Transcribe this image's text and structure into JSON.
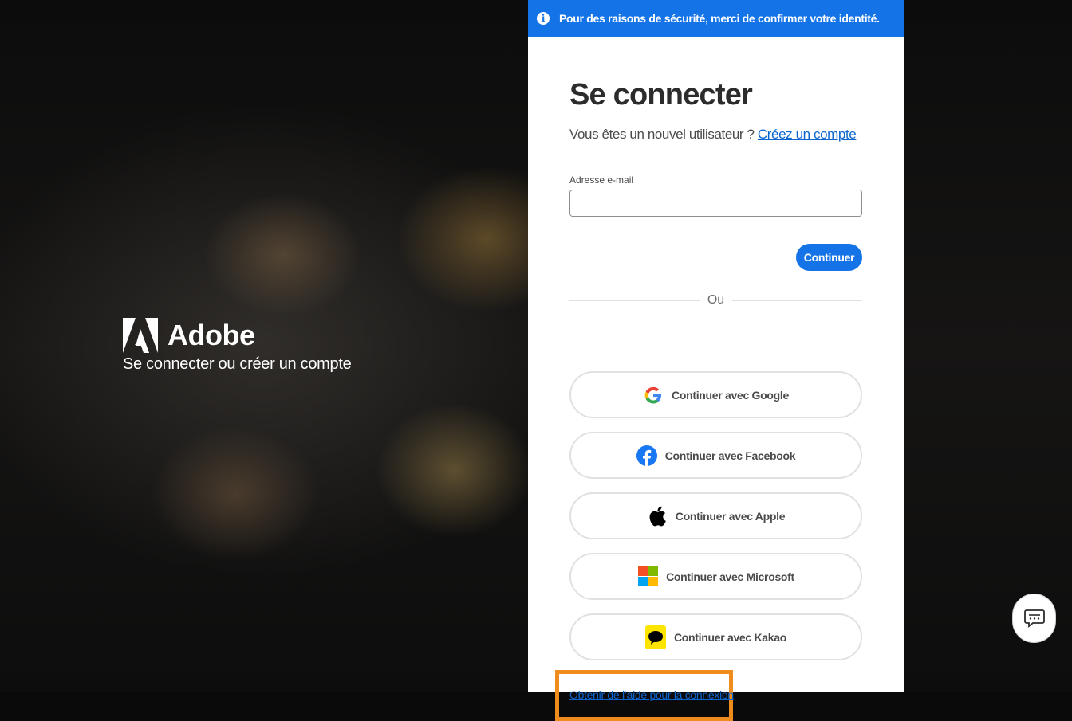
{
  "background": {
    "brand_name": "Adobe",
    "brand_tagline": "Se connecter ou créer un compte"
  },
  "banner": {
    "icon": "info-icon",
    "text": "Pour des raisons de sécurité, merci de confirmer votre identité."
  },
  "signin": {
    "title": "Se connecter",
    "new_user_text": "Vous êtes un nouvel utilisateur ?",
    "create_account_link": "Créez un compte",
    "email_label": "Adresse e-mail",
    "email_value": "",
    "continue_label": "Continuer",
    "divider_text": "Ou"
  },
  "social_buttons": [
    {
      "label": "Continuer avec Google",
      "icon": "google-icon"
    },
    {
      "label": "Continuer avec Facebook",
      "icon": "facebook-icon",
      "color": "#1877f2"
    },
    {
      "label": "Continuer avec Apple",
      "icon": "apple-icon"
    },
    {
      "label": "Continuer avec Microsoft",
      "icon": "microsoft-icon"
    },
    {
      "label": "Continuer avec Kakao",
      "icon": "kakao-icon",
      "color": "#fee500"
    }
  ],
  "help_link": "Obtenir de l’aide pour la connexion",
  "chat": {
    "icon": "chat-icon"
  },
  "colors": {
    "accent": "#1473e6",
    "link": "#0d66d0",
    "highlight": "#f08c1d"
  }
}
